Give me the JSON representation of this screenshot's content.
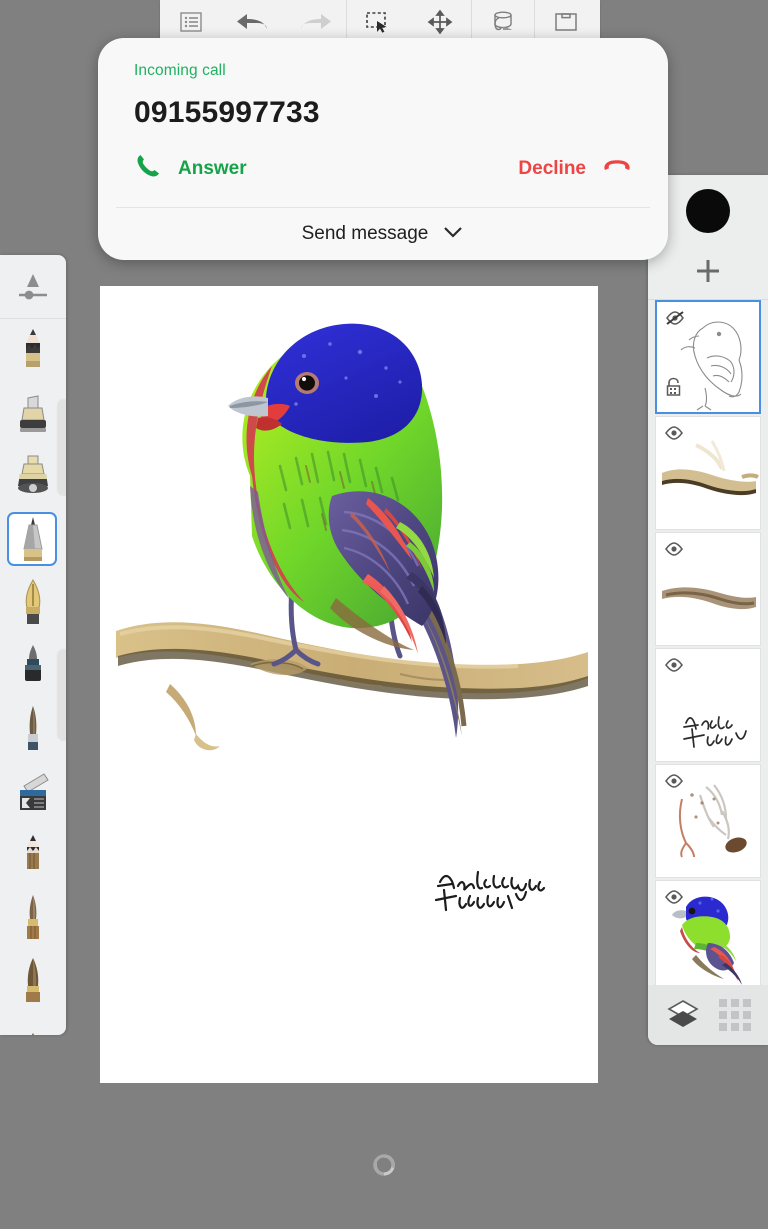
{
  "app": {
    "background_color": "#808080",
    "canvas_color": "#ffffff"
  },
  "top_toolbar": {
    "buttons": [
      {
        "name": "menu-list-icon",
        "label": "Menu",
        "state": "enabled"
      },
      {
        "name": "undo-icon",
        "label": "Undo",
        "state": "enabled"
      },
      {
        "name": "redo-icon",
        "label": "Redo",
        "state": "disabled"
      },
      {
        "name": "select-marquee-icon",
        "label": "Select",
        "state": "enabled"
      },
      {
        "name": "move-transform-icon",
        "label": "Transform",
        "state": "enabled"
      },
      {
        "name": "paint-bucket-icon",
        "label": "Fill",
        "state": "enabled"
      },
      {
        "name": "canvas-layers-icon",
        "label": "Canvas",
        "state": "enabled"
      }
    ]
  },
  "left_toolbar": {
    "tools": [
      {
        "name": "brush-size-slider",
        "label": "Brush size"
      },
      {
        "name": "tool-pencil",
        "label": "Pencil"
      },
      {
        "name": "tool-marker",
        "label": "Marker"
      },
      {
        "name": "tool-airbrush",
        "label": "Airbrush"
      },
      {
        "name": "tool-ink-pen",
        "label": "Ink pen"
      },
      {
        "name": "tool-calligraphy",
        "label": "Calligraphy pen"
      },
      {
        "name": "tool-felt-tip",
        "label": "Felt tip"
      },
      {
        "name": "tool-round-brush",
        "label": "Round brush"
      },
      {
        "name": "tool-palette-knife",
        "label": "Palette knife"
      },
      {
        "name": "tool-soft-pencil",
        "label": "Soft pencil"
      },
      {
        "name": "tool-flat-brush",
        "label": "Flat brush"
      },
      {
        "name": "tool-bristle-brush",
        "label": "Bristle brush"
      },
      {
        "name": "tool-wide-brush",
        "label": "Wide brush"
      }
    ],
    "selected_index": 4
  },
  "layers_panel": {
    "color_swatch": "#0a0a0a",
    "add_layer_icon": "plus-icon",
    "layers": [
      {
        "name": "layer-sketch-outline",
        "visible": false,
        "locked": true,
        "selected": true,
        "content": "bird-line-sketch"
      },
      {
        "name": "layer-branch-detail",
        "visible": true,
        "locked": false,
        "selected": false,
        "content": "branch-highlights"
      },
      {
        "name": "layer-branch-base",
        "visible": true,
        "locked": false,
        "selected": false,
        "content": "branch-base"
      },
      {
        "name": "layer-signature",
        "visible": true,
        "locked": false,
        "selected": false,
        "content": "signature"
      },
      {
        "name": "layer-bird-underpaint",
        "visible": true,
        "locked": false,
        "selected": false,
        "content": "bird-underpaint"
      },
      {
        "name": "layer-bird-color",
        "visible": true,
        "locked": false,
        "selected": false,
        "content": "bird-color"
      }
    ],
    "footer": {
      "layers_icon": "layers-stack-icon",
      "grid_icon": "grid-3x3-icon"
    }
  },
  "bottom_bar": {
    "rotate_icon": "rotate-canvas-icon"
  },
  "incoming_call": {
    "status_label": "Incoming call",
    "status_color": "#20b161",
    "number": "09155997733",
    "answer_label": "Answer",
    "answer_color": "#16a34a",
    "answer_icon": "phone-answer-icon",
    "decline_label": "Decline",
    "decline_color": "#ef4444",
    "decline_icon": "phone-decline-icon",
    "send_message_label": "Send message",
    "send_message_icon": "chevron-down-icon"
  },
  "artwork": {
    "subject": "Painted Bunting perched on a branch",
    "signature_text": "Adelekan"
  }
}
